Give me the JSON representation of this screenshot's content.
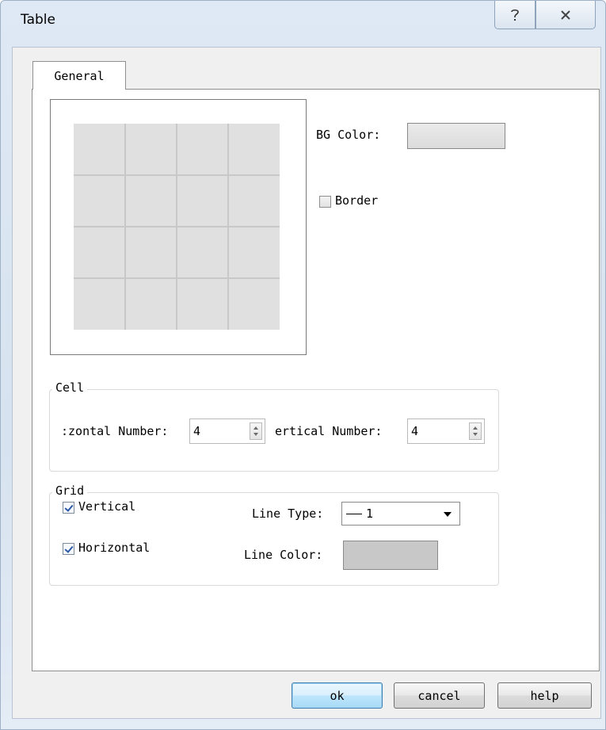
{
  "window": {
    "title": "Table"
  },
  "titlebar": {
    "help_glyph": "?",
    "close_glyph": "✕"
  },
  "tabs": [
    {
      "label": "General"
    }
  ],
  "general": {
    "preview": {
      "rows": 4,
      "cols": 4
    },
    "bg_color": {
      "label": "BG Color:",
      "value": "#e0e0e0"
    },
    "border": {
      "label": "Border",
      "checked": false
    },
    "cell": {
      "legend": "Cell",
      "horizontal_label": ":zontal Number:",
      "horizontal_value": "4",
      "vertical_label": "ertical Number:",
      "vertical_value": "4"
    },
    "grid": {
      "legend": "Grid",
      "vertical_label": "Vertical",
      "vertical_checked": true,
      "horizontal_label": "Horizontal",
      "horizontal_checked": true,
      "line_type_label": "Line Type:",
      "line_type_value": "1",
      "line_color_label": "Line Color:",
      "line_color_value": "#c8c8c8"
    }
  },
  "footer": {
    "ok": "ok",
    "cancel": "cancel",
    "help": "help"
  },
  "colors": {
    "accent": "#3c7fb1",
    "titlebar": "#dfe9f5"
  }
}
